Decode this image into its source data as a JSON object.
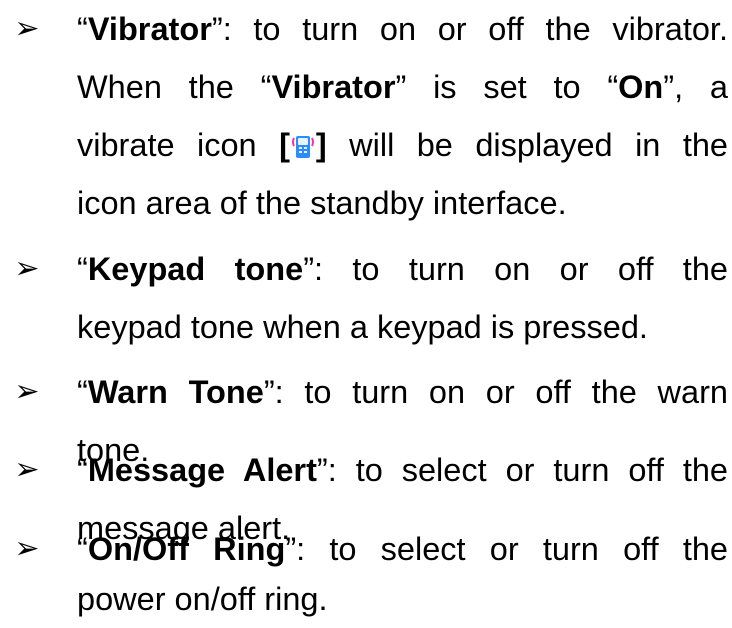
{
  "items": [
    {
      "term": "Vibrator",
      "l1_rest": ": to turn on or off the vibrator.",
      "l2_a": "When the “",
      "l2_term": "Vibrator",
      "l2_b": "” is set to “",
      "l2_on": "On",
      "l2_c": "”, a",
      "l3_a": "vibrate icon ",
      "l3_bracket_open": "[",
      "icon": "vibrate-icon",
      "l3_bracket_close": "]",
      "l3_b": " will be displayed in the",
      "l4": "icon area of the standby interface."
    },
    {
      "term": "Keypad tone",
      "l1_rest": ": to turn on or off the",
      "l2": "keypad tone when a keypad is pressed."
    },
    {
      "term": "Warn Tone",
      "l1_rest": ": to turn on or off the warn",
      "l2": "tone."
    },
    {
      "term": "Message Alert",
      "l1_rest": ": to select or turn off the",
      "l2": "message alert."
    },
    {
      "term": "On/Off Ring",
      "l1_rest": ": to select or turn off the",
      "l2": "power on/off ring."
    }
  ],
  "bullet_glyph": "➢",
  "open_quote": "“",
  "close_quote": "”",
  "icon_colors": {
    "frame": "#ff2ea6",
    "body": "#2a8cff",
    "screen": "#e6f3ff"
  }
}
